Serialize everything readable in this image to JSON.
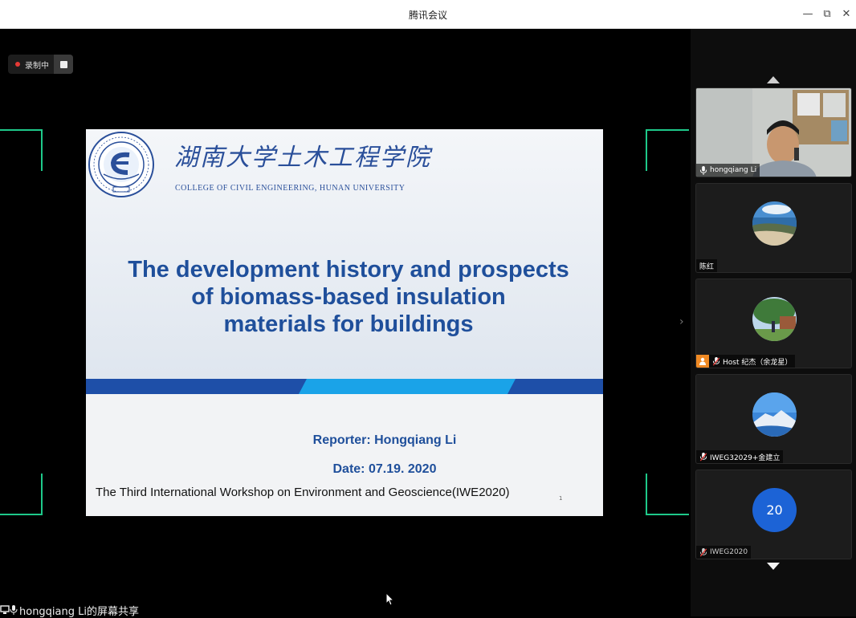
{
  "window": {
    "title": "腾讯会议",
    "minimize_glyph": "—",
    "restore_glyph": "⧉",
    "close_glyph": "✕"
  },
  "recording": {
    "label": "录制中"
  },
  "slide": {
    "cn_school": "湖南大学土木工程学院",
    "en_school": "COLLEGE OF CIVIL ENGINEERING, HUNAN UNIVERSITY",
    "title_lines": [
      "The development history and prospects",
      "of biomass-based insulation",
      "materials for buildings"
    ],
    "reporter": "Reporter:  Hongqiang   Li",
    "date": "Date: 07.19. 2020",
    "workshop": "The Third International Workshop on Environment and Geoscience(IWE2020)",
    "page_number": "1",
    "colors": {
      "primary": "#1f4f9b",
      "band_dark": "#1e4fa8",
      "band_light": "#1aa3e8"
    }
  },
  "share_status": "hongqiang Li的屏幕共享",
  "participants": [
    {
      "name": "hongqiang Li",
      "type": "camera"
    },
    {
      "name": "陈红",
      "type": "avatar"
    },
    {
      "name": "Host 纪杰（余龙星）",
      "type": "avatar",
      "is_host": true
    },
    {
      "name": "IWEG32029+金建立",
      "type": "avatar"
    },
    {
      "name": "IWEG2020",
      "type": "number",
      "avatar_text": "20"
    }
  ],
  "icons": {
    "scroll_up": "triangle-up-icon",
    "scroll_down": "triangle-down-icon",
    "collapse": "chevron-right-icon",
    "collapse_glyph": "›"
  }
}
